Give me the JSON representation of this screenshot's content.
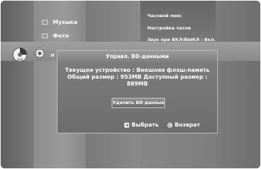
{
  "menu": {
    "items": [
      {
        "label": "Музыка",
        "icon": "music-icon"
      },
      {
        "label": "Фото",
        "icon": "photo-icon"
      },
      {
        "label": "Н",
        "icon": "setup-icon"
      }
    ]
  },
  "submenu": {
    "items": [
      {
        "label": "Часовой пояс"
      },
      {
        "label": "Настройка часов"
      },
      {
        "label": "Звук при ВКЛ/ВЫКЛ :  Вкл."
      }
    ]
  },
  "disc_icon_label": "DVD",
  "dialog": {
    "title": "Управл. BD-данными",
    "lines": [
      "Текущее устройство : Внешняя флэш-память",
      "Общий размер : 953MB     Доступный размер :",
      "889MB"
    ],
    "delete_button": "Удалить BD данные",
    "footer": {
      "select_label": "Выбрать",
      "return_label": "Возврат"
    }
  },
  "colors": {
    "text": "#ffffff",
    "dialog_bg": "#727272",
    "border": "#bdbdbd"
  }
}
